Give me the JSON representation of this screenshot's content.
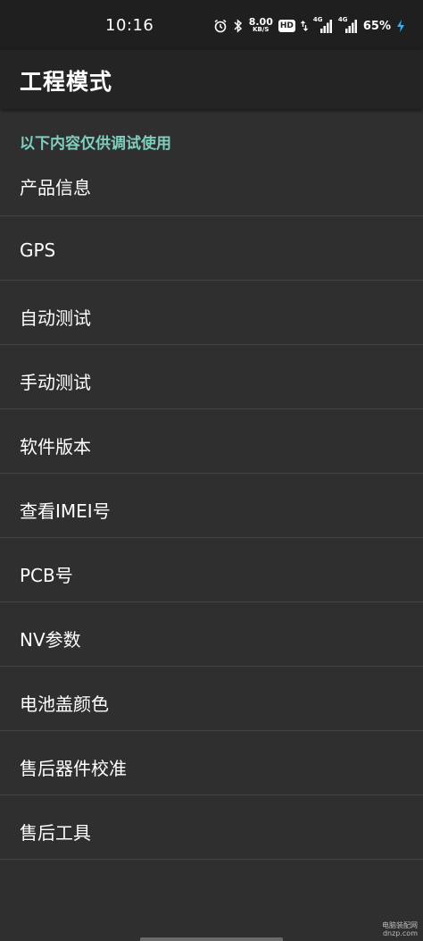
{
  "status_bar": {
    "time": "10:16",
    "net_speed_value": "8.00",
    "net_speed_unit": "KB/S",
    "hd_badge": "HD",
    "sim1_tag": "4G",
    "sim2_tag": "4G",
    "battery": "65%",
    "icons": [
      "alarm-icon",
      "bluetooth-icon",
      "hd-icon",
      "data-arrows-icon",
      "signal-icon",
      "signal-icon",
      "charging-icon"
    ]
  },
  "app_bar": {
    "title": "工程模式"
  },
  "section": {
    "header": "以下内容仅供调试使用"
  },
  "items": [
    {
      "label": "产品信息"
    },
    {
      "label": "GPS"
    },
    {
      "label": "自动测试"
    },
    {
      "label": "手动测试"
    },
    {
      "label": "软件版本"
    },
    {
      "label": "查看IMEI号"
    },
    {
      "label": "PCB号"
    },
    {
      "label": "NV参数"
    },
    {
      "label": "电池盖颜色"
    },
    {
      "label": "售后器件校准"
    },
    {
      "label": "售后工具"
    }
  ],
  "watermark": {
    "line1": "电脑装配网",
    "line2": "dnzp.com"
  },
  "colors": {
    "background": "#2f2f2f",
    "app_bar": "#242424",
    "status_bar": "#1f1f1f",
    "section_header": "#7fcfc0",
    "divider": "#444444",
    "charging": "#29b6f6"
  }
}
